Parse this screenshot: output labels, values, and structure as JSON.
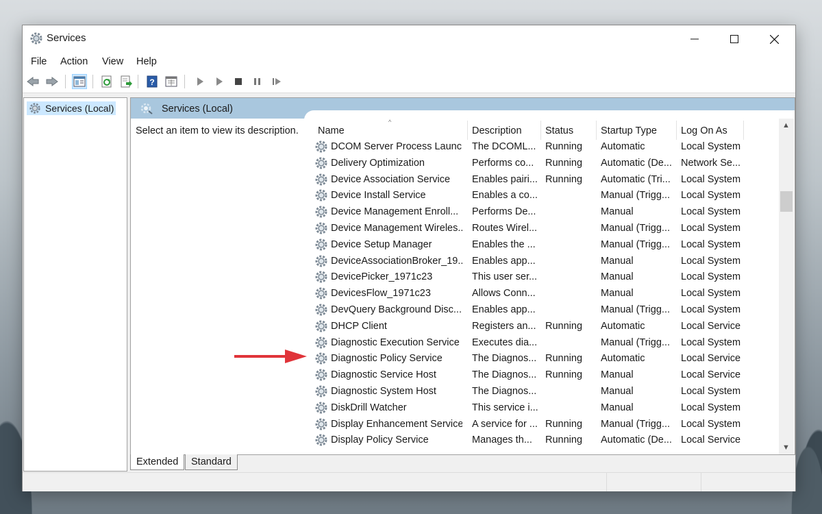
{
  "window": {
    "title": "Services"
  },
  "menu": [
    "File",
    "Action",
    "View",
    "Help"
  ],
  "tree": {
    "root": "Services (Local)"
  },
  "pane": {
    "header": "Services (Local)",
    "description_prompt": "Select an item to view its description."
  },
  "table": {
    "columns": [
      "Name",
      "Description",
      "Status",
      "Startup Type",
      "Log On As"
    ],
    "rows": [
      [
        "DCOM Server Process Launc...",
        "The DCOML...",
        "Running",
        "Automatic",
        "Local System"
      ],
      [
        "Delivery Optimization",
        "Performs co...",
        "Running",
        "Automatic (De...",
        "Network Se..."
      ],
      [
        "Device Association Service",
        "Enables pairi...",
        "Running",
        "Automatic (Tri...",
        "Local System"
      ],
      [
        "Device Install Service",
        "Enables a co...",
        "",
        "Manual (Trigg...",
        "Local System"
      ],
      [
        "Device Management Enroll...",
        "Performs De...",
        "",
        "Manual",
        "Local System"
      ],
      [
        "Device Management Wireles...",
        "Routes Wirel...",
        "",
        "Manual (Trigg...",
        "Local System"
      ],
      [
        "Device Setup Manager",
        "Enables the ...",
        "",
        "Manual (Trigg...",
        "Local System"
      ],
      [
        "DeviceAssociationBroker_19...",
        "Enables app...",
        "",
        "Manual",
        "Local System"
      ],
      [
        "DevicePicker_1971c23",
        "This user ser...",
        "",
        "Manual",
        "Local System"
      ],
      [
        "DevicesFlow_1971c23",
        "Allows Conn...",
        "",
        "Manual",
        "Local System"
      ],
      [
        "DevQuery Background Disc...",
        "Enables app...",
        "",
        "Manual (Trigg...",
        "Local System"
      ],
      [
        "DHCP Client",
        "Registers an...",
        "Running",
        "Automatic",
        "Local Service"
      ],
      [
        "Diagnostic Execution Service",
        "Executes dia...",
        "",
        "Manual (Trigg...",
        "Local System"
      ],
      [
        "Diagnostic Policy Service",
        "The Diagnos...",
        "Running",
        "Automatic",
        "Local Service"
      ],
      [
        "Diagnostic Service Host",
        "The Diagnos...",
        "Running",
        "Manual",
        "Local Service"
      ],
      [
        "Diagnostic System Host",
        "The Diagnos...",
        "",
        "Manual",
        "Local System"
      ],
      [
        "DiskDrill Watcher",
        "This service i...",
        "",
        "Manual",
        "Local System"
      ],
      [
        "Display Enhancement Service",
        "A service for ...",
        "Running",
        "Manual (Trigg...",
        "Local System"
      ],
      [
        "Display Policy Service",
        "Manages th...",
        "Running",
        "Automatic (De...",
        "Local Service"
      ]
    ]
  },
  "tabs": [
    "Extended",
    "Standard"
  ],
  "toolbar_icons": [
    "back-arrow-icon",
    "forward-arrow-icon",
    "show-hide-tree-icon",
    "refresh-icon",
    "export-list-icon",
    "help-icon",
    "properties-icon",
    "start-service-icon",
    "start-service-alt-icon",
    "stop-service-icon",
    "pause-service-icon",
    "restart-service-icon"
  ],
  "colors": {
    "header_blue": "#a9c7de",
    "selected": "#cce8ff",
    "annotation_arrow": "#e0343a"
  }
}
